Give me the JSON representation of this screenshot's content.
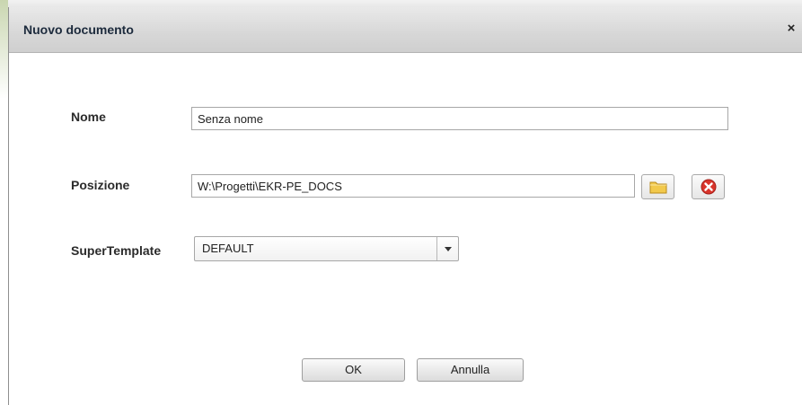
{
  "dialog": {
    "title": "Nuovo documento",
    "close_label": "×"
  },
  "form": {
    "name": {
      "label": "Nome",
      "value": "Senza nome"
    },
    "position": {
      "label": "Posizione",
      "value": "W:\\Progetti\\EKR-PE_DOCS",
      "browse_icon": "folder-icon",
      "clear_icon": "delete-icon"
    },
    "supertemplate": {
      "label": "SuperTemplate",
      "selected": "DEFAULT"
    }
  },
  "buttons": {
    "ok": "OK",
    "cancel": "Annulla"
  },
  "colors": {
    "title_text": "#1c2a3c",
    "delete_red": "#d9342b",
    "folder_yellow": "#f2c94c"
  }
}
